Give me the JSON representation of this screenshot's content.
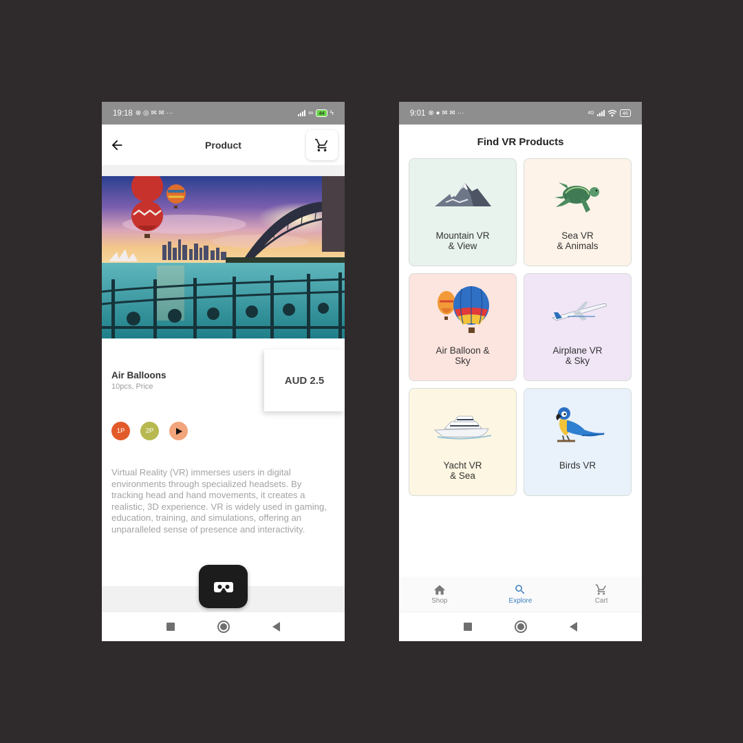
{
  "colors": {
    "background": "#2f2a2b",
    "status_bar": "#8e8e8e",
    "accent_blue": "#3a7ec0",
    "chip_1p": "#e25a2a",
    "chip_2p": "#b7b850",
    "chip_play": "#f2a47a",
    "fab": "#1c1c1c",
    "card_mountain": "#e7f3ec",
    "card_sea": "#fdf3e8",
    "card_balloon": "#fce4df",
    "card_airplane": "#f0e6f6",
    "card_yacht": "#fdf6e2",
    "card_birds": "#e9f1fb"
  },
  "product_screen": {
    "status": {
      "time": "19:18",
      "icons": "⊗ ◎ ✉ ✉ ···",
      "battery": "44"
    },
    "app_bar": {
      "title": "Product",
      "back_icon": "arrow-left-icon",
      "cart_icon": "cart-icon"
    },
    "product": {
      "name": "Air Balloons",
      "subtitle": "10pcs, Price",
      "price": "AUD 2.5"
    },
    "chips": [
      {
        "label": "1P"
      },
      {
        "label": "2P"
      },
      {
        "label": "",
        "icon": "play-icon"
      }
    ],
    "description": "Virtual Reality (VR) immerses users in digital environments through specialized headsets. By tracking head and hand movements, it creates a realistic, 3D experience. VR is widely used in gaming, education, training, and simulations, offering an unparalleled sense of presence and interactivity.",
    "fab_icon": "vr-headset-icon"
  },
  "explore_screen": {
    "status": {
      "time": "9:01",
      "icons": "⊗ ● ✉ ✉ ···",
      "network": "4G",
      "battery": "46"
    },
    "heading": "Find VR Products",
    "categories": [
      {
        "label": "Mountain VR\n& View",
        "icon": "mountain-icon"
      },
      {
        "label": "Sea VR\n& Animals",
        "icon": "sea-turtle-icon"
      },
      {
        "label": "Air Balloon &\nSky",
        "icon": "hot-air-balloon-icon"
      },
      {
        "label": "Airplane VR\n& Sky",
        "icon": "airplane-icon"
      },
      {
        "label": "Yacht VR\n& Sea",
        "icon": "yacht-icon"
      },
      {
        "label": "Birds VR",
        "icon": "parrot-icon"
      }
    ],
    "bottom_nav": [
      {
        "label": "Shop",
        "icon": "home-icon"
      },
      {
        "label": "Explore",
        "icon": "search-icon",
        "active": true
      },
      {
        "label": "Cart",
        "icon": "cart-icon"
      }
    ]
  }
}
